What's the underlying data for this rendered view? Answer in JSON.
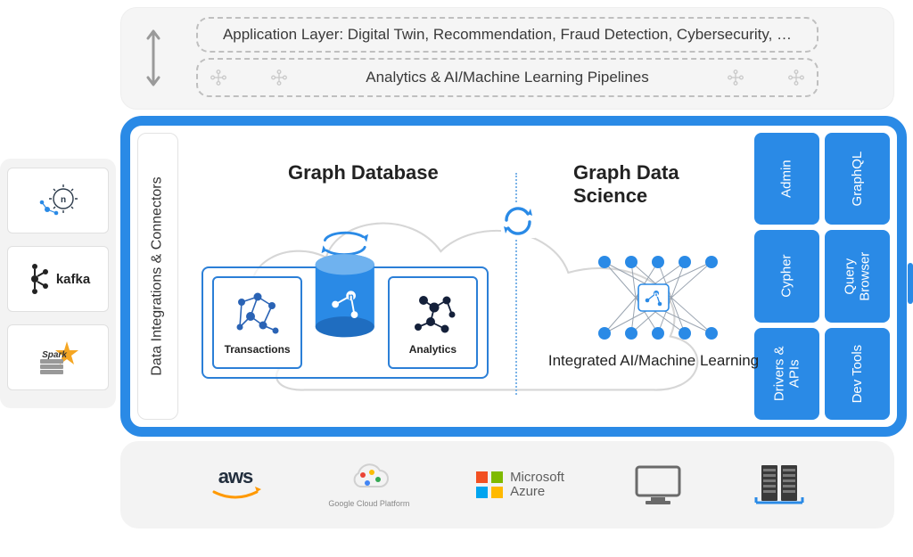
{
  "top": {
    "application_layer": "Application Layer: Digital Twin, Recommendation, Fraud Detection, Cybersecurity, …",
    "pipelines": "Analytics & AI/Machine Learning Pipelines"
  },
  "left_connectors": {
    "neo4j_etl": "Neo4j",
    "kafka": "kafka",
    "spark": "Spark"
  },
  "main": {
    "data_integrations": "Data Integrations & Connectors",
    "graph_database": "Graph Database",
    "graph_data_science": "Graph Data Science",
    "transactions": "Transactions",
    "analytics": "Analytics",
    "integrated_ml": "Integrated AI/Machine Learning",
    "right": {
      "admin": "Admin",
      "graphql": "GraphQL",
      "cypher": "Cypher",
      "query_browser": "Query\nBrowser",
      "drivers_apis": "Drivers &\nAPIs",
      "dev_tools": "Dev Tools"
    }
  },
  "infra": {
    "aws": "aws",
    "gcp": "Google Cloud Platform",
    "azure": "Microsoft\nAzure",
    "onprem": "On-prem",
    "datacenter": "Data center"
  }
}
